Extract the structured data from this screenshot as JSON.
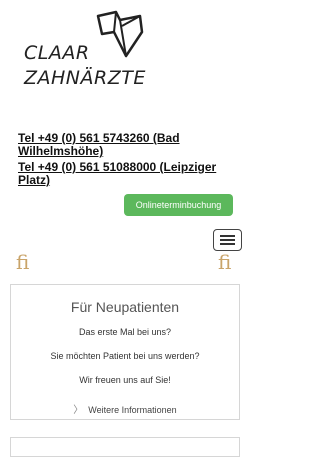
{
  "logo": {
    "line1": "CLAAR",
    "line2": "ZAHNÄRZTE",
    "icon": "tooth-icon"
  },
  "contact": {
    "phones": [
      "Tel +49 (0) 561 5743260 (Bad Wilhelmshöhe)",
      "Tel +49 (0) 561 51088000 (Leipziger Platz)"
    ]
  },
  "booking_button": {
    "label": "Onlineterminbuchung",
    "color": "#5cb85c"
  },
  "menu": {
    "icon": "hamburger-menu-icon"
  },
  "ornament": {
    "glyph": "fi",
    "color": "#c9a46a"
  },
  "new_patients": {
    "title": "Für Neupatienten",
    "lines": [
      "Das erste Mal bei uns?",
      "Sie möchten Patient bei uns werden?",
      "Wir freuen uns auf Sie!"
    ],
    "more_label": "Weitere Informationen"
  }
}
